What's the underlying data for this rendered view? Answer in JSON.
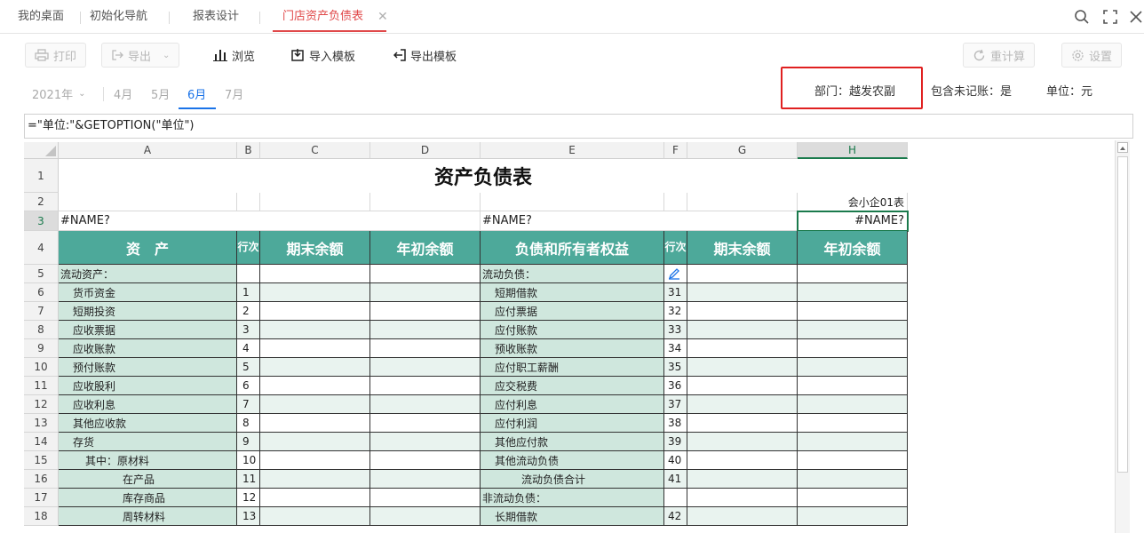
{
  "tabs": [
    {
      "label": "我的桌面"
    },
    {
      "label": "初始化导航"
    },
    {
      "label": "报表设计"
    },
    {
      "label": "门店资产负债表",
      "active": true
    }
  ],
  "toolbar": {
    "print": "打印",
    "export": "导出",
    "browse": "浏览",
    "import_template": "导入模板",
    "export_template": "导出模板",
    "recalc": "重计算",
    "settings": "设置"
  },
  "period": {
    "year": "2021年",
    "months": [
      "4月",
      "5月",
      "6月",
      "7月"
    ],
    "active_month": "6月"
  },
  "options": {
    "department": "部门：越发农副",
    "include_unposted": "包含未记账：是",
    "unit": "单位：元"
  },
  "formula": "=\"单位:\"&GETOPTION(\"单位\")",
  "columns": [
    "A",
    "B",
    "C",
    "D",
    "E",
    "F",
    "G",
    "H"
  ],
  "row_numbers": [
    "1",
    "2",
    "3",
    "4",
    "5",
    "6",
    "7",
    "8",
    "9",
    "10",
    "11",
    "12",
    "13",
    "14",
    "15",
    "16",
    "17",
    "18"
  ],
  "sheet": {
    "title": "资产负债表",
    "form_code": "会小企01表",
    "r3_a": "#NAME?",
    "r3_e": "#NAME?",
    "r3_h": "#NAME?",
    "headers": {
      "assets": "资　产",
      "line_no": "行次",
      "end_balance": "期末余额",
      "begin_balance": "年初余额",
      "liabilities": "负债和所有者权益",
      "line_no2": "行次",
      "end_balance2": "期末余额",
      "begin_balance2": "年初余额"
    },
    "rows": [
      {
        "a": "流动资产：",
        "b": "",
        "e": "流动负债：",
        "f": ""
      },
      {
        "a": "货币资金",
        "b": "1",
        "e": "短期借款",
        "f": "31"
      },
      {
        "a": "短期投资",
        "b": "2",
        "e": "应付票据",
        "f": "32"
      },
      {
        "a": "应收票据",
        "b": "3",
        "e": "应付账款",
        "f": "33"
      },
      {
        "a": "应收账款",
        "b": "4",
        "e": "预收账款",
        "f": "34"
      },
      {
        "a": "预付账款",
        "b": "5",
        "e": "应付职工薪酬",
        "f": "35"
      },
      {
        "a": "应收股利",
        "b": "6",
        "e": "应交税费",
        "f": "36"
      },
      {
        "a": "应收利息",
        "b": "7",
        "e": "应付利息",
        "f": "37"
      },
      {
        "a": "其他应收款",
        "b": "8",
        "e": "应付利润",
        "f": "38"
      },
      {
        "a": "存货",
        "b": "9",
        "e": "其他应付款",
        "f": "39"
      },
      {
        "a": "其中：原材料",
        "b": "10",
        "e": "其他流动负债",
        "f": "40"
      },
      {
        "a": "在产品",
        "b": "11",
        "e": "流动负债合计",
        "f": "41"
      },
      {
        "a": "库存商品",
        "b": "12",
        "e": "非流动负债：",
        "f": ""
      },
      {
        "a": "周转材料",
        "b": "13",
        "e": "长期借款",
        "f": "42"
      }
    ]
  }
}
